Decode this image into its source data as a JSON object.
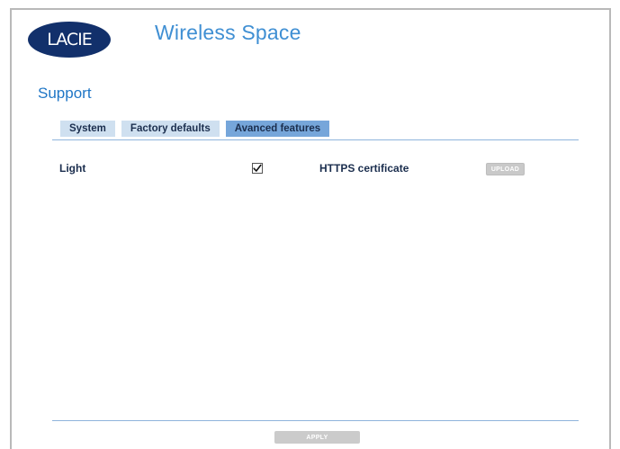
{
  "header": {
    "logo_text": "LACIE",
    "product_title": "Wireless Space"
  },
  "page": {
    "section_title": "Support"
  },
  "tabs": [
    {
      "label": "System",
      "active": false
    },
    {
      "label": "Factory defaults",
      "active": false
    },
    {
      "label": "Avanced features",
      "active": true
    }
  ],
  "settings": {
    "light_label": "Light",
    "light_checked": true,
    "https_label": "HTTPS certificate",
    "upload_label": "UPLOAD"
  },
  "footer": {
    "apply_label": "APPLY"
  },
  "colors": {
    "brand_navy": "#12306b",
    "title_blue": "#3f8fd3",
    "tab_active": "#76a6da",
    "tab_inactive": "#cfe0f0",
    "button_disabled": "#cbcbcb"
  }
}
